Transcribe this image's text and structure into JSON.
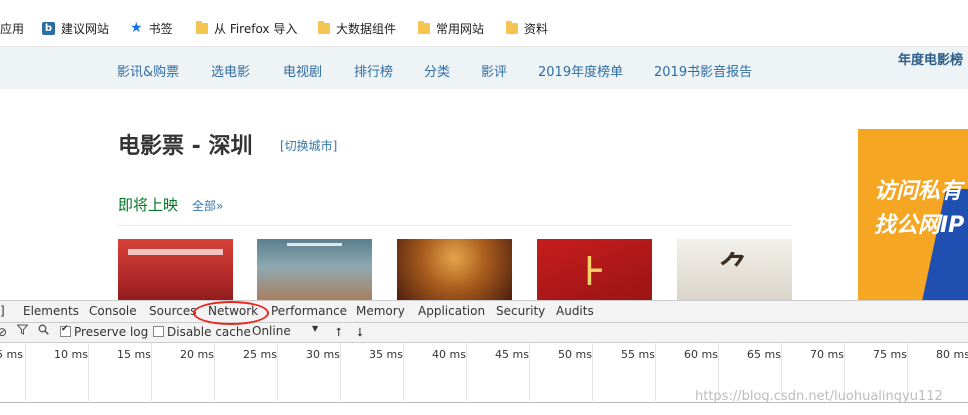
{
  "bookmarks": {
    "items": [
      {
        "label": "应用",
        "icon": "apps-icon"
      },
      {
        "label": "建议网站",
        "icon": "bing-icon"
      },
      {
        "label": "书签",
        "icon": "star-icon"
      },
      {
        "label": "从 Firefox 导入",
        "icon": "folder-icon"
      },
      {
        "label": "大数据组件",
        "icon": "folder-icon"
      },
      {
        "label": "常用网站",
        "icon": "folder-icon"
      },
      {
        "label": "资料",
        "icon": "folder-icon"
      }
    ]
  },
  "site_nav": {
    "items": [
      "影讯&购票",
      "选电影",
      "电视剧",
      "排行榜",
      "分类",
      "影评",
      "2019年度榜单",
      "2019书影音报告"
    ],
    "right_label": "年度电影榜"
  },
  "main": {
    "title": "电影票 - 深圳",
    "switch_city": "[切换城市]",
    "coming_soon": "即将上映",
    "all_link": "全部»"
  },
  "ad": {
    "line1": "访问私有",
    "line2": "找公网IP"
  },
  "devtools": {
    "dock_glyph": "]",
    "tabs": [
      "Elements",
      "Console",
      "Sources",
      "Network",
      "Performance",
      "Memory",
      "Application",
      "Security",
      "Audits"
    ],
    "active_tab": "Network",
    "toolbar": {
      "preserve_log": "Preserve log",
      "disable_cache": "Disable cache",
      "throttle": "Online"
    },
    "timeline_ticks": [
      "5 ms",
      "10 ms",
      "15 ms",
      "20 ms",
      "25 ms",
      "30 ms",
      "35 ms",
      "40 ms",
      "45 ms",
      "50 ms",
      "55 ms",
      "60 ms",
      "65 ms",
      "70 ms",
      "75 ms",
      "80 ms"
    ]
  },
  "watermark": "https://blog.csdn.net/luohualingyu112",
  "colors": {
    "nav_bg": "#eef3f6",
    "link_blue": "#2e6da4",
    "green": "#007722",
    "highlight_red": "#e8261f"
  }
}
